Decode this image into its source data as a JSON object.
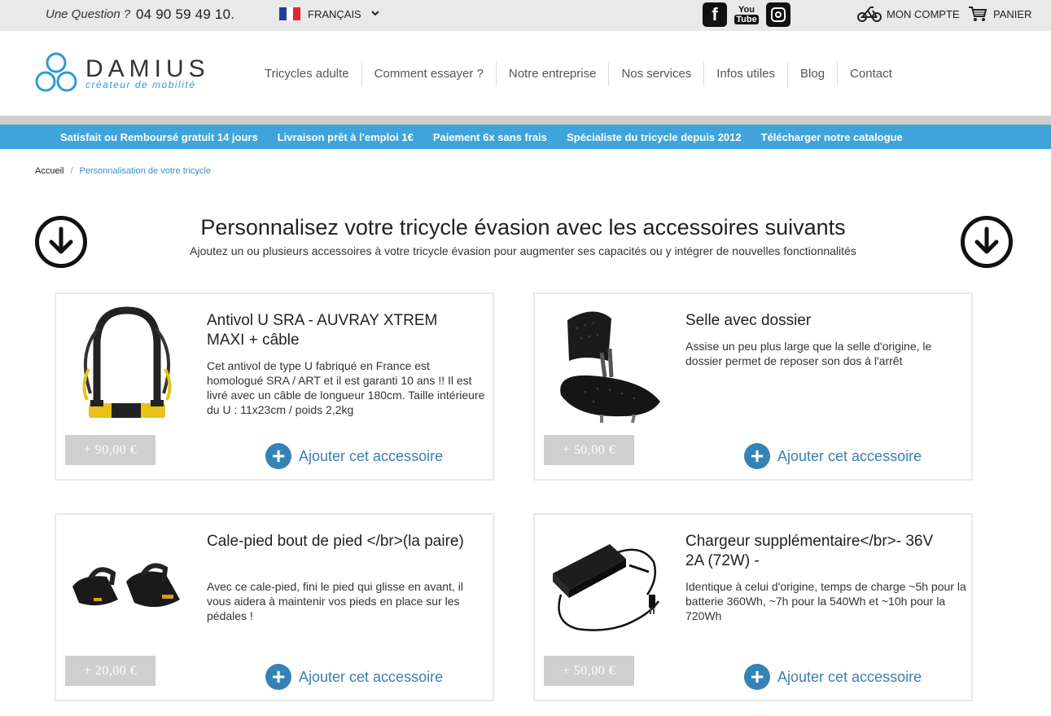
{
  "topbar": {
    "question": "Une Question ?",
    "phone": "04 90 59 49 10.",
    "language": "FRANÇAIS",
    "account": "MON COMPTE",
    "cart": "PANIER",
    "youtube_top": "You",
    "youtube_bottom": "Tube"
  },
  "logo": {
    "name": "DAMIUS",
    "tagline": "créateur de mobilité"
  },
  "nav": [
    "Tricycles adulte",
    "Comment essayer ?",
    "Notre entreprise",
    "Nos services",
    "Infos utiles",
    "Blog",
    "Contact"
  ],
  "promo_bar": [
    "Satisfait ou Remboursé gratuit 14 jours",
    "Livraison prêt à l'emploi 1€",
    "Paiement 6x sans frais",
    "Spécialiste du tricycle depuis 2012",
    "Télécharger notre catalogue"
  ],
  "breadcrumb": {
    "home": "Accueil",
    "separator": "/",
    "current": "Personnalisation de votre tricycle"
  },
  "page": {
    "title": "Personnalisez votre tricycle évasion avec les accessoires suivants",
    "subtitle": "Ajoutez un ou plusieurs accessoires à votre tricycle évasion pour augmenter ses capacités ou y intégrer de nouvelles fonctionnalités"
  },
  "products": [
    {
      "title": "Antivol U SRA - AUVRAY XTREM MAXI + câble",
      "description": "Cet antivol de type U fabriqué en France est homologué SRA / ART et il est garanti 10 ans !! Il est livré avec un câble de longueur 180cm. Taille intérieure du U : 11x23cm / poids 2,2kg",
      "price": "+ 90,00 €",
      "add_label": "Ajouter cet accessoire",
      "image_icon": "u-lock-image"
    },
    {
      "title": "Selle avec dossier",
      "description": "Assise un peu plus large que la selle d'origine, le dossier permet de reposer son dos à l'arrêt",
      "price": "+ 50,00 €",
      "add_label": "Ajouter cet accessoire",
      "image_icon": "saddle-image"
    },
    {
      "title": "Cale-pied bout de pied </br>(la paire)",
      "description": "Avec ce cale-pied, fini le pied qui glisse en avant, il vous aidera à maintenir vos pieds en place sur les pédales !",
      "price": "+ 20,00 €",
      "add_label": "Ajouter cet accessoire",
      "image_icon": "pedal-image"
    },
    {
      "title": "Chargeur supplémentaire</br>- 36V 2A (72W) -",
      "description": "Identique à celui d'origine, temps de charge ~5h pour la batterie 360Wh, ~7h pour la 540Wh et ~10h pour la 720Wh",
      "price": "+ 50,00 €",
      "add_label": "Ajouter cet accessoire",
      "image_icon": "charger-image"
    }
  ],
  "colors": {
    "accent_blue": "#3fa4db",
    "button_blue": "#3583b5",
    "price_gray": "#cfcfcf",
    "topbar_gray": "#e9e9e9"
  }
}
